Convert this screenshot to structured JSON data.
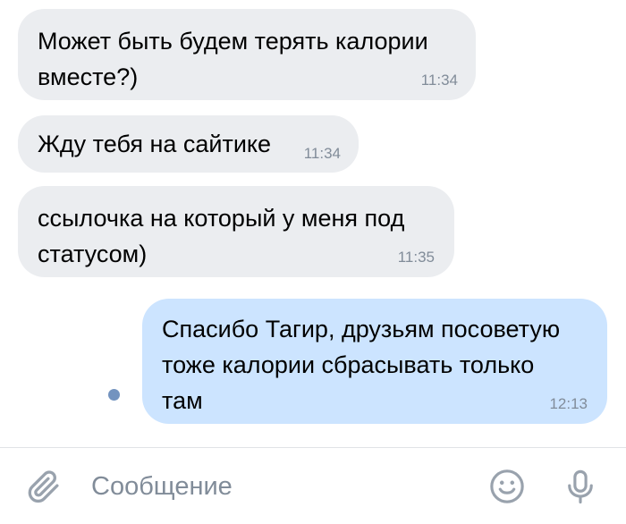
{
  "messages": [
    {
      "direction": "incoming",
      "text": "Может быть будем терять калории\nвместе?)",
      "time": "11:34"
    },
    {
      "direction": "incoming",
      "text": "Жду тебя на сайтике",
      "time": "11:34"
    },
    {
      "direction": "incoming",
      "text": "ссылочка на который у меня под\nстатусом)",
      "time": "11:35"
    },
    {
      "direction": "outgoing",
      "text": "Спасибо Тагир, друзьям посоветую\nтоже калории сбрасывать только\nтам",
      "time": "12:13",
      "unread": true
    }
  ],
  "composer": {
    "placeholder": "Сообщение",
    "value": "",
    "icons": [
      "paperclip-icon",
      "smile-icon",
      "microphone-icon"
    ]
  },
  "colors": {
    "incoming_bubble": "#ebedf0",
    "outgoing_bubble": "#cce4ff",
    "timestamp": "#818c99",
    "icon": "#99a2ad",
    "unread_dot": "#7393bf"
  }
}
